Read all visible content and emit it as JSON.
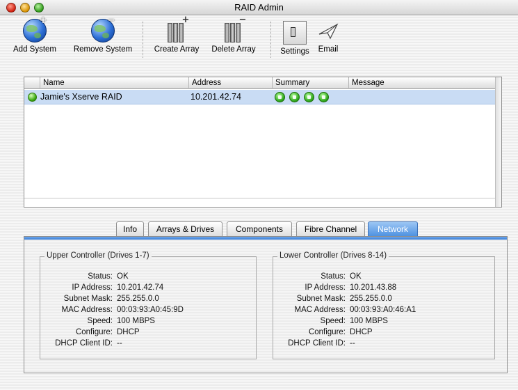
{
  "window": {
    "title": "RAID Admin"
  },
  "toolbar": {
    "add_system": "Add System",
    "remove_system": "Remove System",
    "create_array": "Create Array",
    "delete_array": "Delete Array",
    "settings": "Settings",
    "email": "Email"
  },
  "table": {
    "columns": [
      "Name",
      "Address",
      "Summary",
      "Message"
    ],
    "rows": [
      {
        "name": "Jamie's Xserve RAID",
        "address": "10.201.42.74",
        "message": ""
      }
    ]
  },
  "tabs": [
    "Info",
    "Arrays & Drives",
    "Components",
    "Fibre Channel",
    "Network"
  ],
  "active_tab": "Network",
  "labels": {
    "status": "Status:",
    "ip": "IP Address:",
    "subnet": "Subnet Mask:",
    "mac": "MAC Address:",
    "speed": "Speed:",
    "configure": "Configure:",
    "dhcp": "DHCP Client ID:"
  },
  "upper": {
    "title": "Upper Controller (Drives 1-7)",
    "status": "OK",
    "ip": "10.201.42.74",
    "subnet": "255.255.0.0",
    "mac": "00:03:93:A0:45:9D",
    "speed": "100 MBPS",
    "configure": "DHCP",
    "dhcp": "--"
  },
  "lower": {
    "title": "Lower Controller (Drives 8-14)",
    "status": "OK",
    "ip": "10.201.43.88",
    "subnet": "255.255.0.0",
    "mac": "00:03:93:A0:46:A1",
    "speed": "100 MBPS",
    "configure": "DHCP",
    "dhcp": "--"
  },
  "colors": {
    "selection": "#c9dcf4",
    "active_tab": "#4b8fe0",
    "status_ok": "#3aa80f"
  }
}
